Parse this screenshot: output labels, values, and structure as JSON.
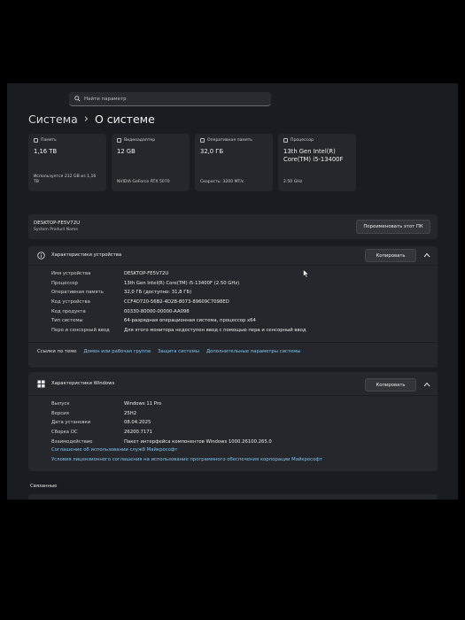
{
  "search": {
    "placeholder": "Найти параметр"
  },
  "breadcrumb": {
    "root": "Система",
    "separator": "›",
    "current": "О системе"
  },
  "cards": [
    {
      "title": "Память",
      "value": "1,16 TB",
      "sub": "Используется 212 GB из 1,16 TB",
      "icon": "storage-icon"
    },
    {
      "title": "Видеоадаптер",
      "value": "12 GB",
      "sub": "NVIDIA GeForce RTX 5070",
      "icon": "gpu-icon"
    },
    {
      "title": "Оперативная память",
      "value": "32,0 ГБ",
      "sub": "Скорость: 3200 MT/c",
      "icon": "ram-icon"
    },
    {
      "title": "Процессор",
      "value": "13th Gen Intel(R) Core(TM) i5-13400F",
      "sub": "2.50 GHz",
      "icon": "cpu-icon"
    }
  ],
  "device": {
    "name": "DESKTOP-FE5V72U",
    "sub": "System Product Name",
    "rename_label": "Переименовать этот ПК"
  },
  "device_specs": {
    "title": "Характеристики устройства",
    "copy_label": "Копировать",
    "rows": [
      {
        "k": "Имя устройства",
        "v": "DESKTOP-FE5V72U"
      },
      {
        "k": "Процессор",
        "v": "13th Gen Intel(R) Core(TM) i5-13400F (2.50 GHz)"
      },
      {
        "k": "Оперативная память",
        "v": "32,0 ГБ (доступно: 31,8 ГБ)"
      },
      {
        "k": "Код устройства",
        "v": "CCF4D720-56B2-4D2B-8073-89609C7098ED"
      },
      {
        "k": "Код продукта",
        "v": "00330-80000-00000-AA098"
      },
      {
        "k": "Тип системы",
        "v": "64-разрядная операционная система, процессор x64"
      },
      {
        "k": "Перо и сенсорный ввод",
        "v": "Для этого монитора недоступен ввод с помощью пера и сенсорный ввод"
      }
    ]
  },
  "related_links": {
    "label": "Ссылки по теме",
    "items": [
      "Домен или рабочая группа",
      "Защита системы",
      "Дополнительные параметры системы"
    ]
  },
  "windows_specs": {
    "title": "Характеристики Windows",
    "copy_label": "Копировать",
    "rows": [
      {
        "k": "Выпуск",
        "v": "Windows 11 Pro"
      },
      {
        "k": "Версия",
        "v": "25H2"
      },
      {
        "k": "Дата установки",
        "v": "08.04.2025"
      },
      {
        "k": "Сборка ОС",
        "v": "26200.7171"
      },
      {
        "k": "Взаимодействие",
        "v": "Пакет интерфейса компонентов Windows 1000.26100.265.0"
      }
    ],
    "links": [
      "Соглашение об использовании служб Майкрософт",
      "Условия лицензионного соглашения на использование программного обеспечения корпорации Майкрософт"
    ]
  },
  "related_section": {
    "title": "Связанные"
  },
  "colors": {
    "accent_link": "#7fc6ee",
    "panel": "#26272d",
    "background": "#1b1c22"
  }
}
